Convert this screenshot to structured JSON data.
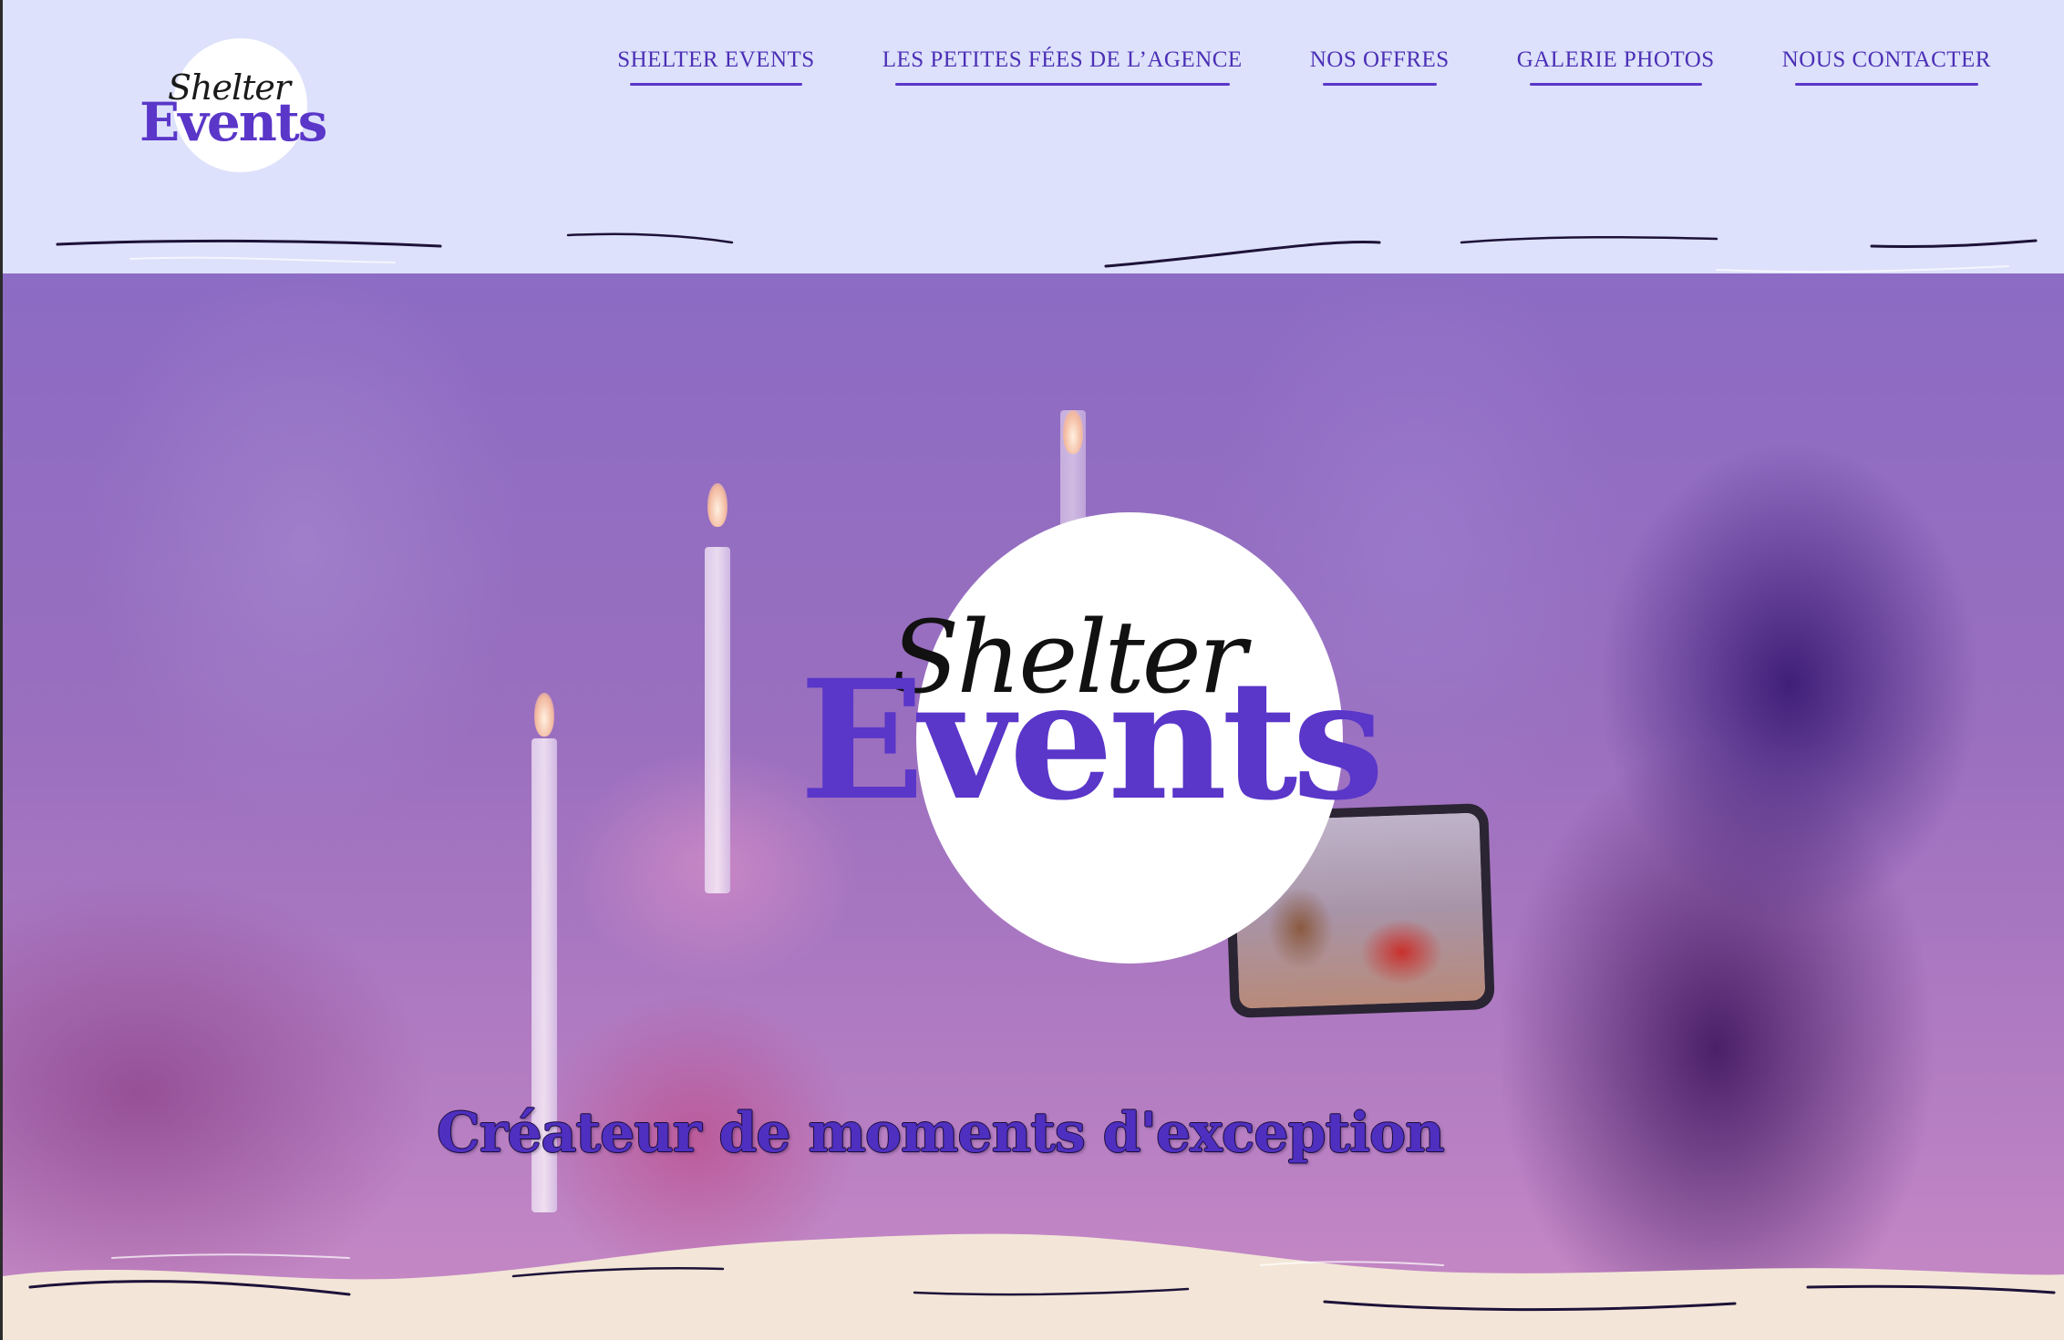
{
  "header": {
    "logo": {
      "script": "Shelter",
      "wordmark": "Events"
    },
    "nav": [
      {
        "label": "SHELTER EVENTS"
      },
      {
        "label": "LES PETITES FÉES DE L’AGENCE"
      },
      {
        "label": "NOS OFFRES"
      },
      {
        "label": "GALERIE PHOTOS"
      },
      {
        "label": "NOUS CONTACTER"
      }
    ]
  },
  "hero": {
    "logo": {
      "script": "Shelter",
      "wordmark": "Events"
    },
    "tagline": "Créateur de moments d'exception"
  },
  "colors": {
    "brand_purple": "#5a36c9",
    "header_bg": "#dde1fb",
    "footer_bg": "#f3e6d8"
  }
}
